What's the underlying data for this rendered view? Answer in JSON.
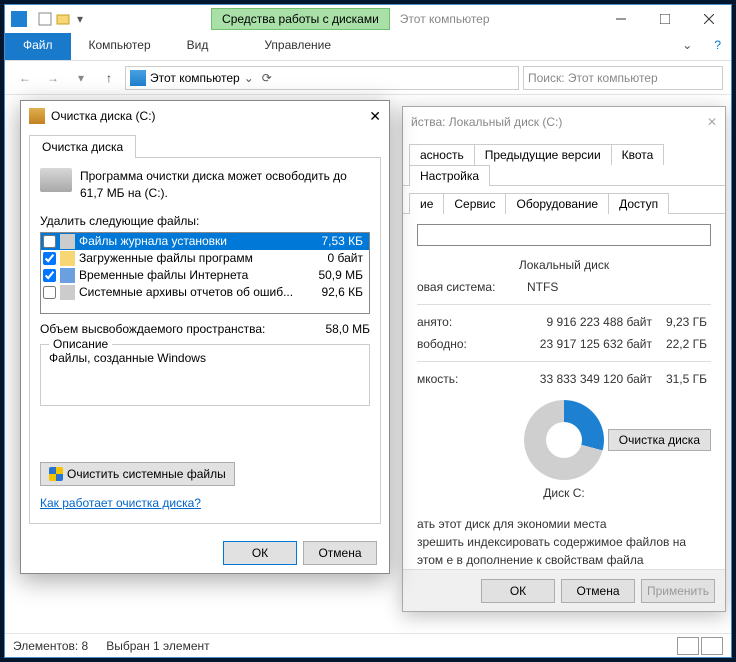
{
  "explorer": {
    "context_tab": "Средства работы с дисками",
    "app_title": "Этот компьютер",
    "file_tab": "Файл",
    "tabs": [
      "Компьютер",
      "Вид"
    ],
    "manage_tab": "Управление",
    "address": "Этот компьютер",
    "search_placeholder": "Поиск: Этот компьютер",
    "status_elements": "Элементов: 8",
    "status_selected": "Выбран 1 элемент"
  },
  "props": {
    "title": "йства: Локальный диск (C:)",
    "tabs_row1": [
      "асность",
      "Предыдущие версии",
      "Квота",
      "Настройка"
    ],
    "tabs_row2": [
      "ие",
      "Сервис",
      "Оборудование",
      "Доступ"
    ],
    "type_label": "Локальный диск",
    "fs_label": "овая система:",
    "fs_value": "NTFS",
    "used_label": "анято:",
    "used_bytes": "9 916 223 488 байт",
    "used_gb": "9,23 ГБ",
    "free_label": "вободно:",
    "free_bytes": "23 917 125 632 байт",
    "free_gb": "22,2 ГБ",
    "cap_label": "мкость:",
    "cap_bytes": "33 833 349 120 байт",
    "cap_gb": "31,5 ГБ",
    "chart_label": "Диск C:",
    "cleanup_btn": "Очистка диска",
    "compress": "ать этот диск для экономии места",
    "index": "зрешить индексировать содержимое файлов на этом е в дополнение к свойствам файла",
    "ok": "ОК",
    "cancel": "Отмена",
    "apply": "Применить"
  },
  "cleanup": {
    "title": "Очистка диска  (C:)",
    "tab": "Очистка диска",
    "info": "Программа очистки диска может освободить до 61,7 МБ на  (C:).",
    "delete_label": "Удалить следующие файлы:",
    "files": [
      {
        "name": "Файлы журнала установки",
        "size": "7,53 КБ",
        "checked": false,
        "selected": true,
        "icon": "file"
      },
      {
        "name": "Загруженные файлы программ",
        "size": "0 байт",
        "checked": true,
        "selected": false,
        "icon": "folder"
      },
      {
        "name": "Временные файлы Интернета",
        "size": "50,9 МБ",
        "checked": true,
        "selected": false,
        "icon": "ie"
      },
      {
        "name": "Системные архивы отчетов об ошиб...",
        "size": "92,6 КБ",
        "checked": false,
        "selected": false,
        "icon": "file"
      }
    ],
    "total_label": "Объем высвобождаемого пространства:",
    "total_value": "58,0 МБ",
    "desc_legend": "Описание",
    "desc_text": "Файлы, созданные Windows",
    "sysfiles_btn": "Очистить системные файлы",
    "help_link": "Как работает очистка диска?",
    "ok": "ОК",
    "cancel": "Отмена"
  },
  "chart_data": {
    "type": "pie",
    "title": "Диск C:",
    "categories": [
      "Занято",
      "Свободно"
    ],
    "values": [
      9.23,
      22.2
    ],
    "unit": "ГБ",
    "total": 31.5,
    "colors": [
      "#1e80d0",
      "#cfcfcf"
    ]
  }
}
